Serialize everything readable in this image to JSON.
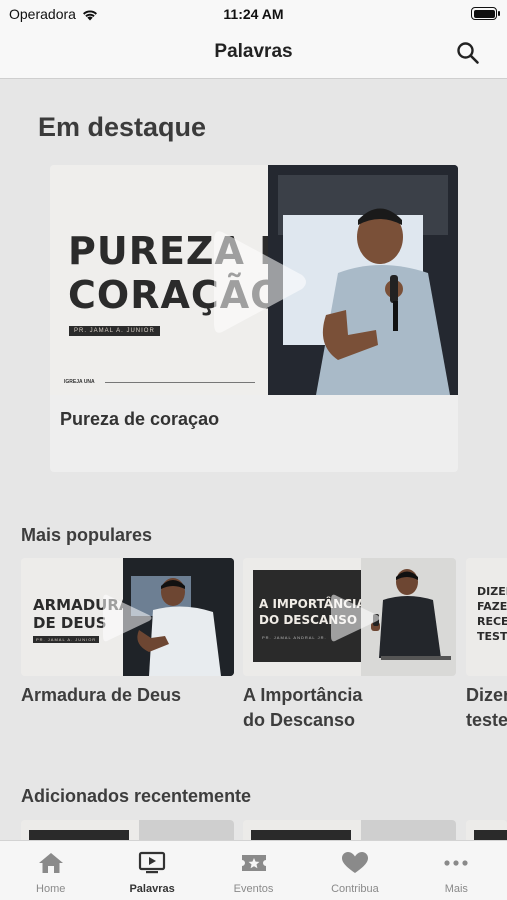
{
  "status_bar": {
    "carrier": "Operadora",
    "time": "11:24 AM"
  },
  "navbar": {
    "title": "Palavras",
    "search_icon": "search-icon"
  },
  "featured": {
    "title": "Em destaque",
    "item": {
      "caption": "Pureza de coraçao",
      "poster_line1": "PUREZA DE",
      "poster_line2": "CORAÇÃO",
      "poster_speaker": "PR. JAMAL A. JUNIOR",
      "poster_brand": "IGREJA UNA"
    }
  },
  "popular": {
    "title": "Mais populares",
    "items": [
      {
        "caption_line1": "Armadura de Deus",
        "caption_line2": "",
        "poster_line1": "ARMADURA",
        "poster_line2": "DE DEUS",
        "poster_speaker": "PR. JAMAL A. JUNIOR"
      },
      {
        "caption_line1": "A Importância",
        "caption_line2": "do Descanso",
        "poster_line1": "A IMPORTÂNCIA",
        "poster_line2": "DO DESCANSO",
        "poster_speaker": "PR. JAMAL ANDRAL JR."
      },
      {
        "caption_line1": "Dizer",
        "caption_line2": "teste",
        "poster_line1": "DIZER",
        "poster_line2": "FAZER",
        "poster_line3": "RECE",
        "poster_line4": "TESTE"
      }
    ]
  },
  "recent": {
    "title": "Adicionados recentemente"
  },
  "tabbar": {
    "tabs": [
      {
        "label": "Home",
        "icon": "home-icon"
      },
      {
        "label": "Palavras",
        "icon": "tv-play-icon",
        "active": true
      },
      {
        "label": "Eventos",
        "icon": "ticket-star-icon"
      },
      {
        "label": "Contribua",
        "icon": "heart-icon"
      },
      {
        "label": "Mais",
        "icon": "more-dots-icon"
      }
    ]
  }
}
